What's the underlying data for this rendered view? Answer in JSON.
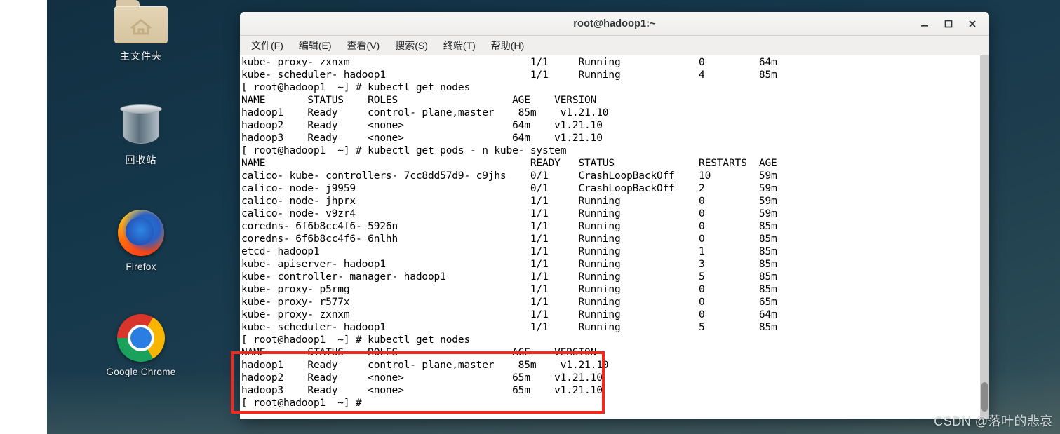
{
  "desktop": {
    "icons": [
      {
        "name": "home-folder",
        "label": "主文件夹",
        "icon": "folder-home-icon"
      },
      {
        "name": "trash",
        "label": "回收站",
        "icon": "trash-can-icon"
      },
      {
        "name": "firefox",
        "label": "Firefox",
        "icon": "firefox-icon"
      },
      {
        "name": "chrome",
        "label": "Google Chrome",
        "icon": "chrome-icon"
      }
    ],
    "watermark": "CSDN @落叶的悲哀"
  },
  "terminal": {
    "title": "root@hadoop1:~",
    "window_buttons": {
      "minimize": "_",
      "maximize": "□",
      "close": "✕"
    },
    "menu": [
      {
        "name": "file",
        "label": "文件(F)"
      },
      {
        "name": "edit",
        "label": "编辑(E)"
      },
      {
        "name": "view",
        "label": "查看(V)"
      },
      {
        "name": "search",
        "label": "搜索(S)"
      },
      {
        "name": "terminal",
        "label": "终端(T)"
      },
      {
        "name": "help",
        "label": "帮助(H)"
      }
    ],
    "content": "kube- proxy- zxnxm                              1/1     Running             0         64m\nkube- scheduler- hadoop1                        1/1     Running             4         85m\n[ root@hadoop1  ~] # kubectl get nodes\nNAME       STATUS    ROLES                   AGE    VERSION\nhadoop1    Ready     control- plane,master    85m    v1.21.10\nhadoop2    Ready     <none>                  64m    v1.21.10\nhadoop3    Ready     <none>                  64m    v1.21.10\n[ root@hadoop1  ~] # kubectl get pods - n kube- system\nNAME                                            READY   STATUS              RESTARTS  AGE\ncalico- kube- controllers- 7cc8dd57d9- c9jhs    0/1     CrashLoopBackOff    10        59m\ncalico- node- j9959                             0/1     CrashLoopBackOff    2         59m\ncalico- node- jhprx                             1/1     Running             0         59m\ncalico- node- v9zr4                             1/1     Running             0         59m\ncoredns- 6f6b8cc4f6- 5926n                      1/1     Running             0         85m\ncoredns- 6f6b8cc4f6- 6nlhh                      1/1     Running             0         85m\netcd- hadoop1                                   1/1     Running             1         85m\nkube- apiserver- hadoop1                        1/1     Running             3         85m\nkube- controller- manager- hadoop1              1/1     Running             5         85m\nkube- proxy- p5rmg                              1/1     Running             0         85m\nkube- proxy- r577x                              1/1     Running             0         65m\nkube- proxy- zxnxm                              1/1     Running             0         64m\nkube- scheduler- hadoop1                        1/1     Running             5         85m\n[ root@hadoop1  ~] # kubectl get nodes\nNAME       STATUS    ROLES                   AGE    VERSION\nhadoop1    Ready     control- plane,master    85m    v1.21.10\nhadoop2    Ready     <none>                  65m    v1.21.10\nhadoop3    Ready     <none>                  65m    v1.21.10\n[ root@hadoop1  ~] # "
  }
}
